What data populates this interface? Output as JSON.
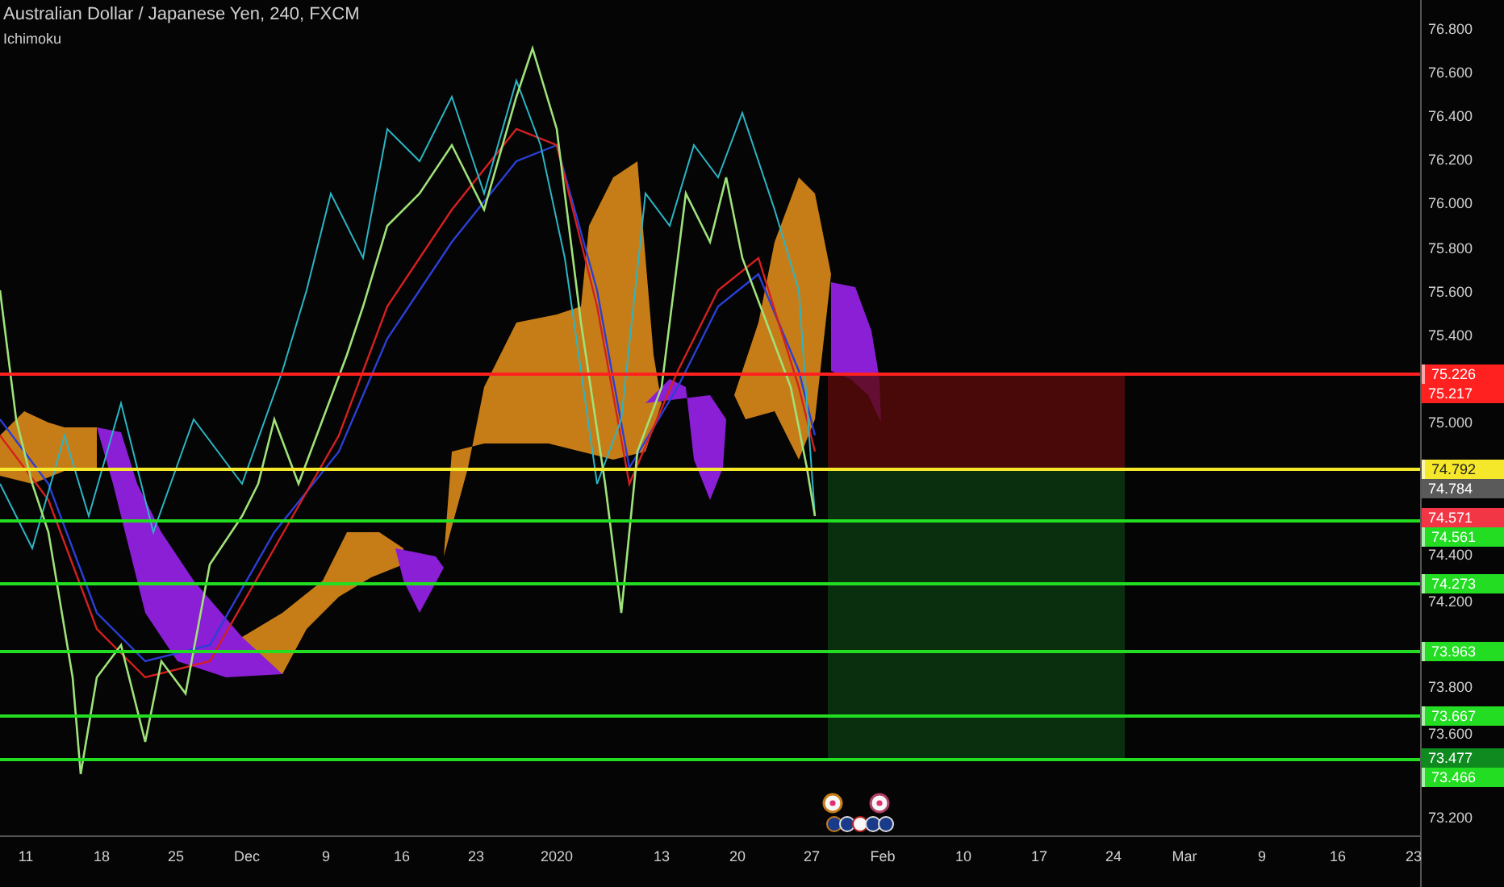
{
  "header": {
    "title": "Australian Dollar / Japanese Yen, 240, FXCM",
    "indicator": "Ichimoku"
  },
  "price_axis": {
    "ticks": [
      "76.800",
      "76.600",
      "76.400",
      "76.200",
      "76.000",
      "75.800",
      "75.600",
      "75.400",
      "75.000",
      "74.400",
      "74.200",
      "73.800",
      "73.600",
      "73.200"
    ]
  },
  "price_levels": [
    {
      "label": "75.226",
      "color": "#ff2020",
      "line": true
    },
    {
      "label": "75.217",
      "color": "#ff2020",
      "line": false
    },
    {
      "label": "74.792",
      "color": "#f5e82a",
      "line": true
    },
    {
      "label": "74.784",
      "color": "#5a5a5a",
      "line": false
    },
    {
      "label": "74.571",
      "color": "#f23645",
      "line": false
    },
    {
      "label": "74.561",
      "color": "#22dd22",
      "line": true
    },
    {
      "label": "74.273",
      "color": "#22dd22",
      "line": true
    },
    {
      "label": "73.963",
      "color": "#22dd22",
      "line": true
    },
    {
      "label": "73.667",
      "color": "#22dd22",
      "line": true
    },
    {
      "label": "73.477",
      "color": "#0f8a1f",
      "line": false
    },
    {
      "label": "73.466",
      "color": "#22dd22",
      "line": true
    }
  ],
  "time_axis": {
    "labels": [
      "11",
      "18",
      "25",
      "Dec",
      "9",
      "16",
      "23",
      "2020",
      "13",
      "20",
      "27",
      "Feb",
      "10",
      "17",
      "24",
      "Mar",
      "9",
      "16",
      "23"
    ]
  }
}
